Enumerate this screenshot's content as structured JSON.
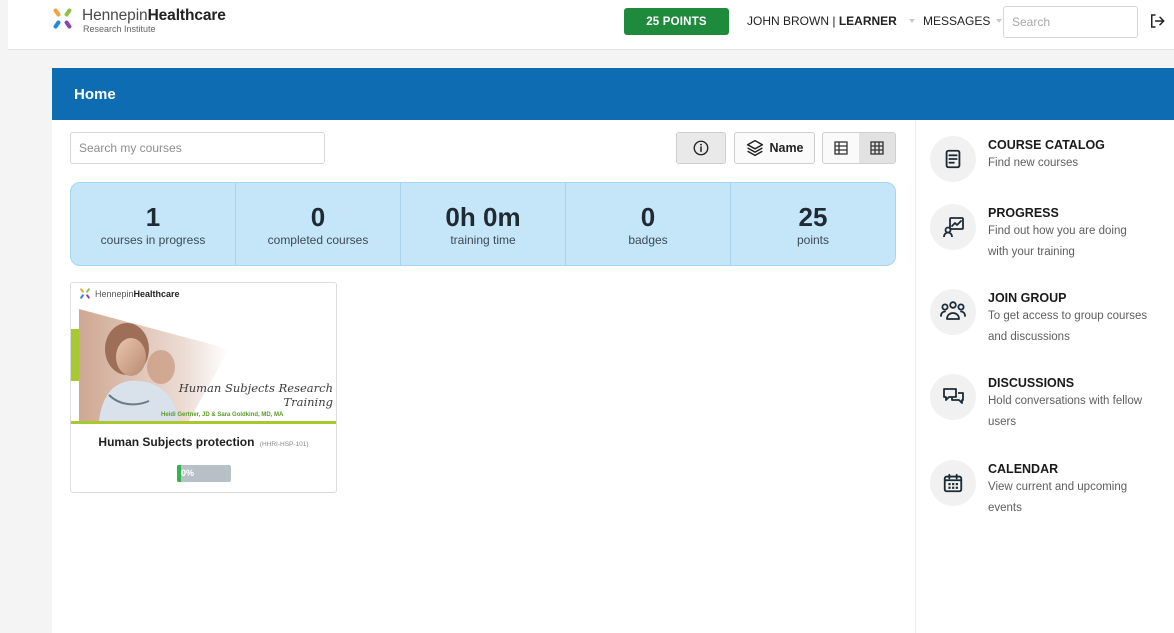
{
  "brand": {
    "name_light": "Hennepin",
    "name_bold": "Healthcare",
    "subtitle": "Research Institute",
    "colors": [
      "#f2a33a",
      "#8bc34a",
      "#1e88e5",
      "#8e44ad"
    ]
  },
  "topbar": {
    "points_label": "25 POINTS",
    "user_name": "JOHN BROWN",
    "user_separator": "|",
    "user_role": "LEARNER",
    "messages_label": "MESSAGES",
    "search_placeholder": "Search",
    "logout_icon": "logout-icon"
  },
  "panel": {
    "title": "Home",
    "search_placeholder": "Search my courses",
    "sort_label": "Name",
    "view_active": "grid"
  },
  "stats": [
    {
      "value": "1",
      "label": "courses in progress"
    },
    {
      "value": "0",
      "label": "completed courses"
    },
    {
      "value": "0h 0m",
      "label": "training time"
    },
    {
      "value": "0",
      "label": "badges"
    },
    {
      "value": "25",
      "label": "points"
    }
  ],
  "courses": [
    {
      "thumb_brand_light": "Hennepin",
      "thumb_brand_bold": "Healthcare",
      "thumb_title_line1": "Human Subjects Research",
      "thumb_title_line2": "Training",
      "thumb_authors": "Heidi Gertner, JD & Sara Goldkind, MD, MA",
      "name": "Human Subjects protection",
      "code": "(HHRI-HSP-101)",
      "progress_text": "0%",
      "progress": 0
    }
  ],
  "sidebar": [
    {
      "icon": "book-icon",
      "title": "COURSE CATALOG",
      "desc": "Find new courses"
    },
    {
      "icon": "progress-chart-icon",
      "title": "PROGRESS",
      "desc": "Find out how you are doing with your training"
    },
    {
      "icon": "group-icon",
      "title": "JOIN GROUP",
      "desc": "To get access to group courses and discussions"
    },
    {
      "icon": "chat-icon",
      "title": "DISCUSSIONS",
      "desc": "Hold conversations with fellow users"
    },
    {
      "icon": "calendar-icon",
      "title": "CALENDAR",
      "desc": "View current and upcoming events"
    }
  ],
  "colors": {
    "header_blue": "#0e6cb3",
    "points_green": "#1e8a3b",
    "stats_bg": "#c5e6f9"
  }
}
